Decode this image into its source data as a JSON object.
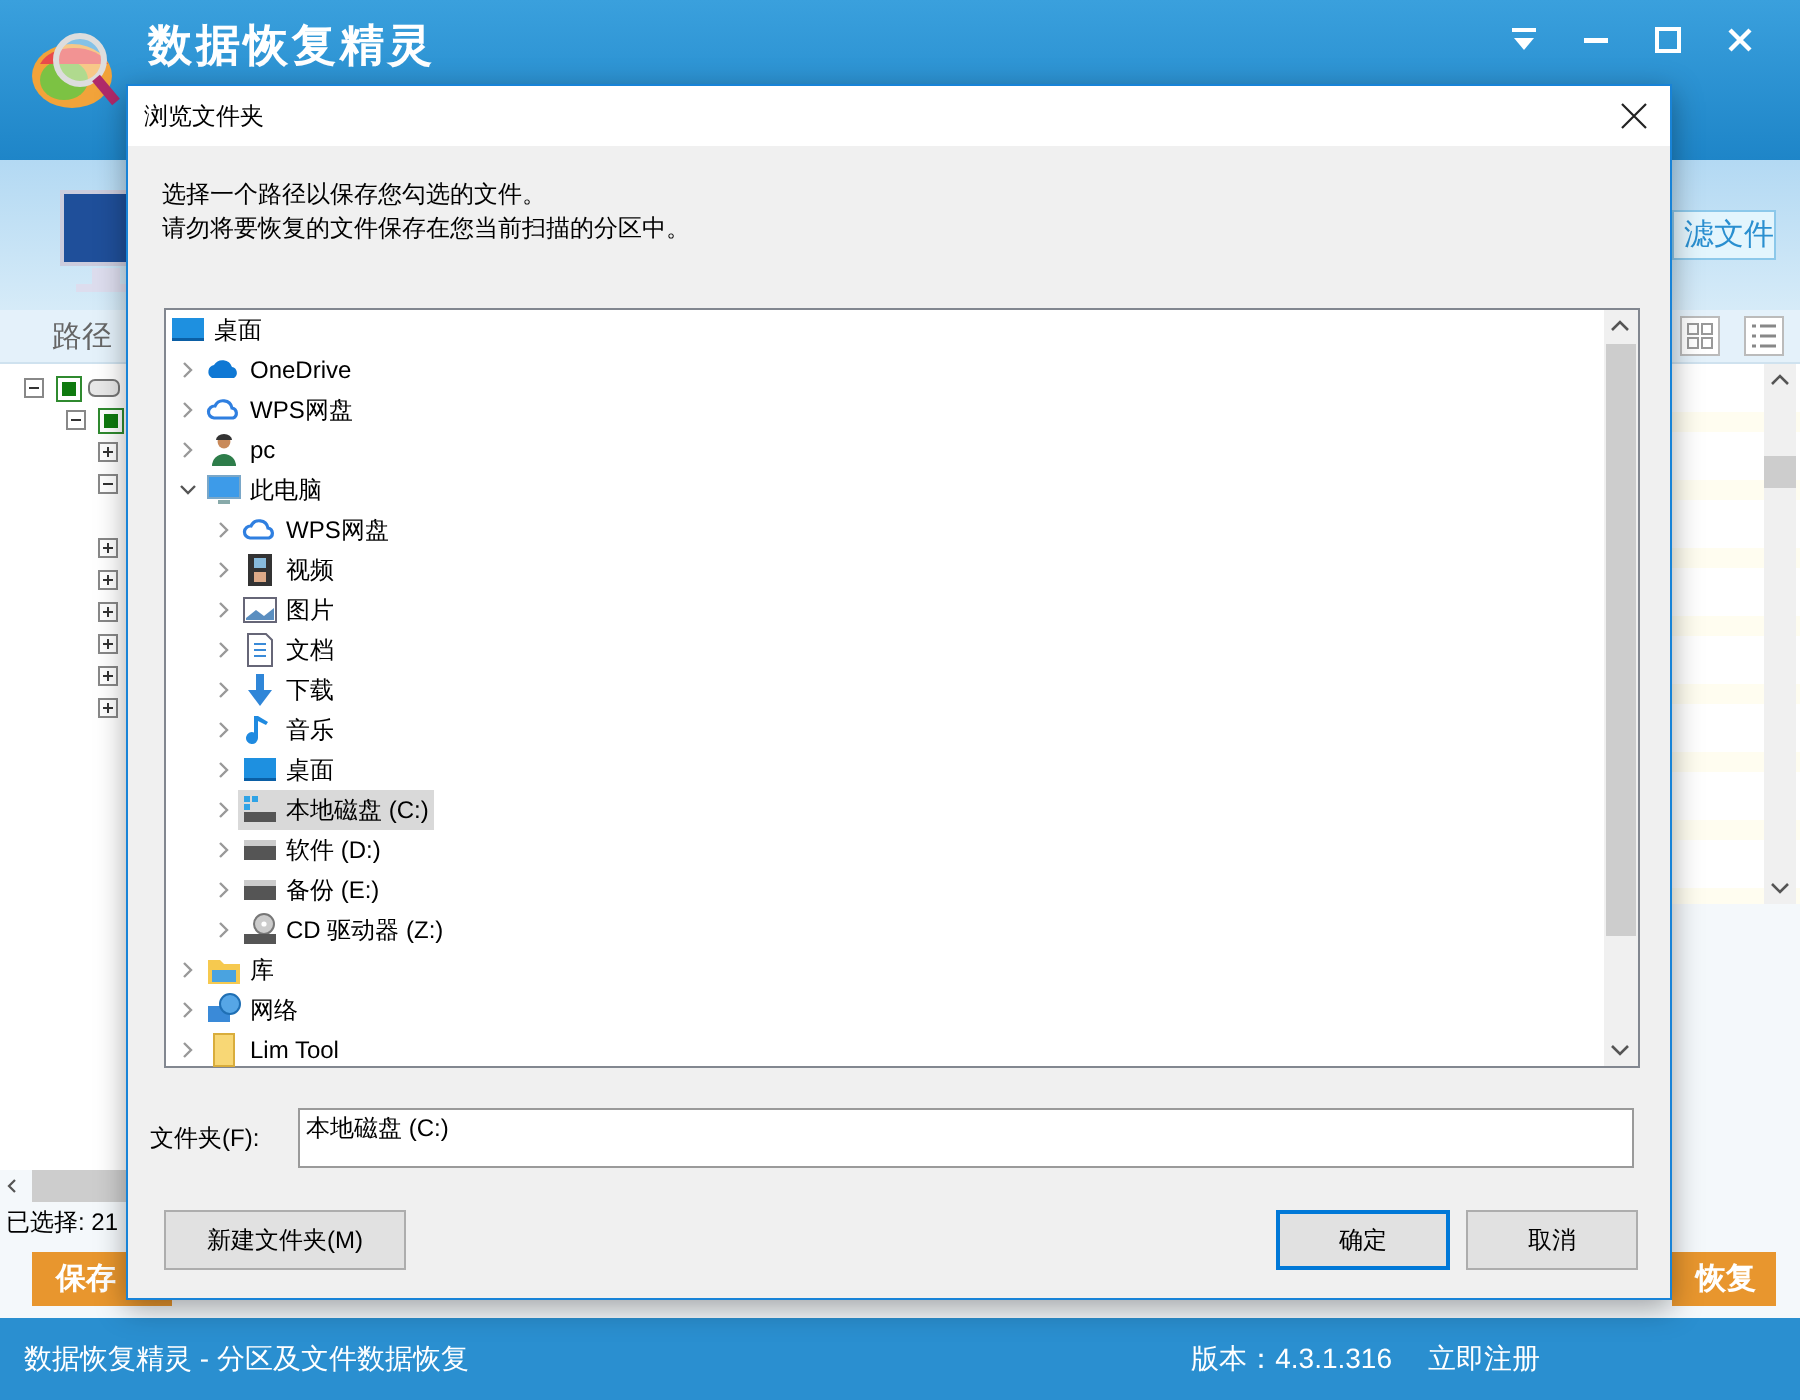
{
  "app": {
    "title": "数据恢复精灵",
    "toolbar_button": "滤文件",
    "column_header": "路径",
    "tree": [
      {
        "checked": true,
        "expanded": true,
        "children": [
          {
            "checked": true,
            "expanded": true,
            "children": [
              {
                "expanded": false
              },
              {
                "expanded": true
              },
              {
                "expanded": false
              },
              {
                "expanded": false
              },
              {
                "expanded": false
              },
              {
                "expanded": false
              },
              {
                "expanded": false
              },
              {
                "expanded": false
              }
            ]
          }
        ]
      }
    ],
    "selection_count": "已选择: 21",
    "buttons": [
      "保存",
      "恢复"
    ],
    "status": "数据恢复精灵 - 分区及文件数据恢复",
    "version": "版本：4.3.1.316",
    "register": "立即注册"
  },
  "dialog": {
    "title": "浏览文件夹",
    "instructions": [
      "选择一个路径以保存您勾选的文件。",
      "请勿将要恢复的文件保存在您当前扫描的分区中。"
    ],
    "tree": {
      "label": "桌面",
      "kind": "desktop",
      "selected": false,
      "children": [
        {
          "label": "OneDrive",
          "kind": "cloud",
          "expanded": false,
          "selected": false
        },
        {
          "label": "WPS网盘",
          "kind": "cloud-outline",
          "expanded": false,
          "selected": false
        },
        {
          "label": "pc",
          "kind": "user",
          "expanded": false,
          "selected": false
        },
        {
          "label": "此电脑",
          "kind": "computer",
          "expanded": true,
          "selected": false,
          "children": [
            {
              "label": "WPS网盘",
              "kind": "cloud-outline",
              "expanded": false,
              "selected": false
            },
            {
              "label": "视频",
              "kind": "video",
              "expanded": false,
              "selected": false
            },
            {
              "label": "图片",
              "kind": "pictures",
              "expanded": false,
              "selected": false
            },
            {
              "label": "文档",
              "kind": "document",
              "expanded": false,
              "selected": false
            },
            {
              "label": "下载",
              "kind": "download",
              "expanded": false,
              "selected": false
            },
            {
              "label": "音乐",
              "kind": "music",
              "expanded": false,
              "selected": false
            },
            {
              "label": "桌面",
              "kind": "desktop",
              "expanded": false,
              "selected": false
            },
            {
              "label": "本地磁盘 (C:)",
              "kind": "system-drive",
              "expanded": false,
              "selected": true
            },
            {
              "label": "软件 (D:)",
              "kind": "drive",
              "expanded": false,
              "selected": false
            },
            {
              "label": "备份 (E:)",
              "kind": "drive",
              "expanded": false,
              "selected": false
            },
            {
              "label": "CD 驱动器 (Z:)",
              "kind": "cd-drive",
              "expanded": false,
              "selected": false
            }
          ]
        },
        {
          "label": "库",
          "kind": "library",
          "expanded": false,
          "selected": false
        },
        {
          "label": "网络",
          "kind": "network",
          "expanded": false,
          "selected": false
        },
        {
          "label": "Lim Tool",
          "kind": "folder",
          "expanded": false,
          "selected": false
        }
      ]
    },
    "folder_label": "文件夹(F):",
    "folder_value": "本地磁盘 (C:)",
    "buttons": [
      {
        "label": "新建文件夹(M)",
        "kind": "new-folder"
      },
      {
        "label": "确定",
        "kind": "default"
      },
      {
        "label": "取消",
        "kind": "normal"
      }
    ]
  }
}
